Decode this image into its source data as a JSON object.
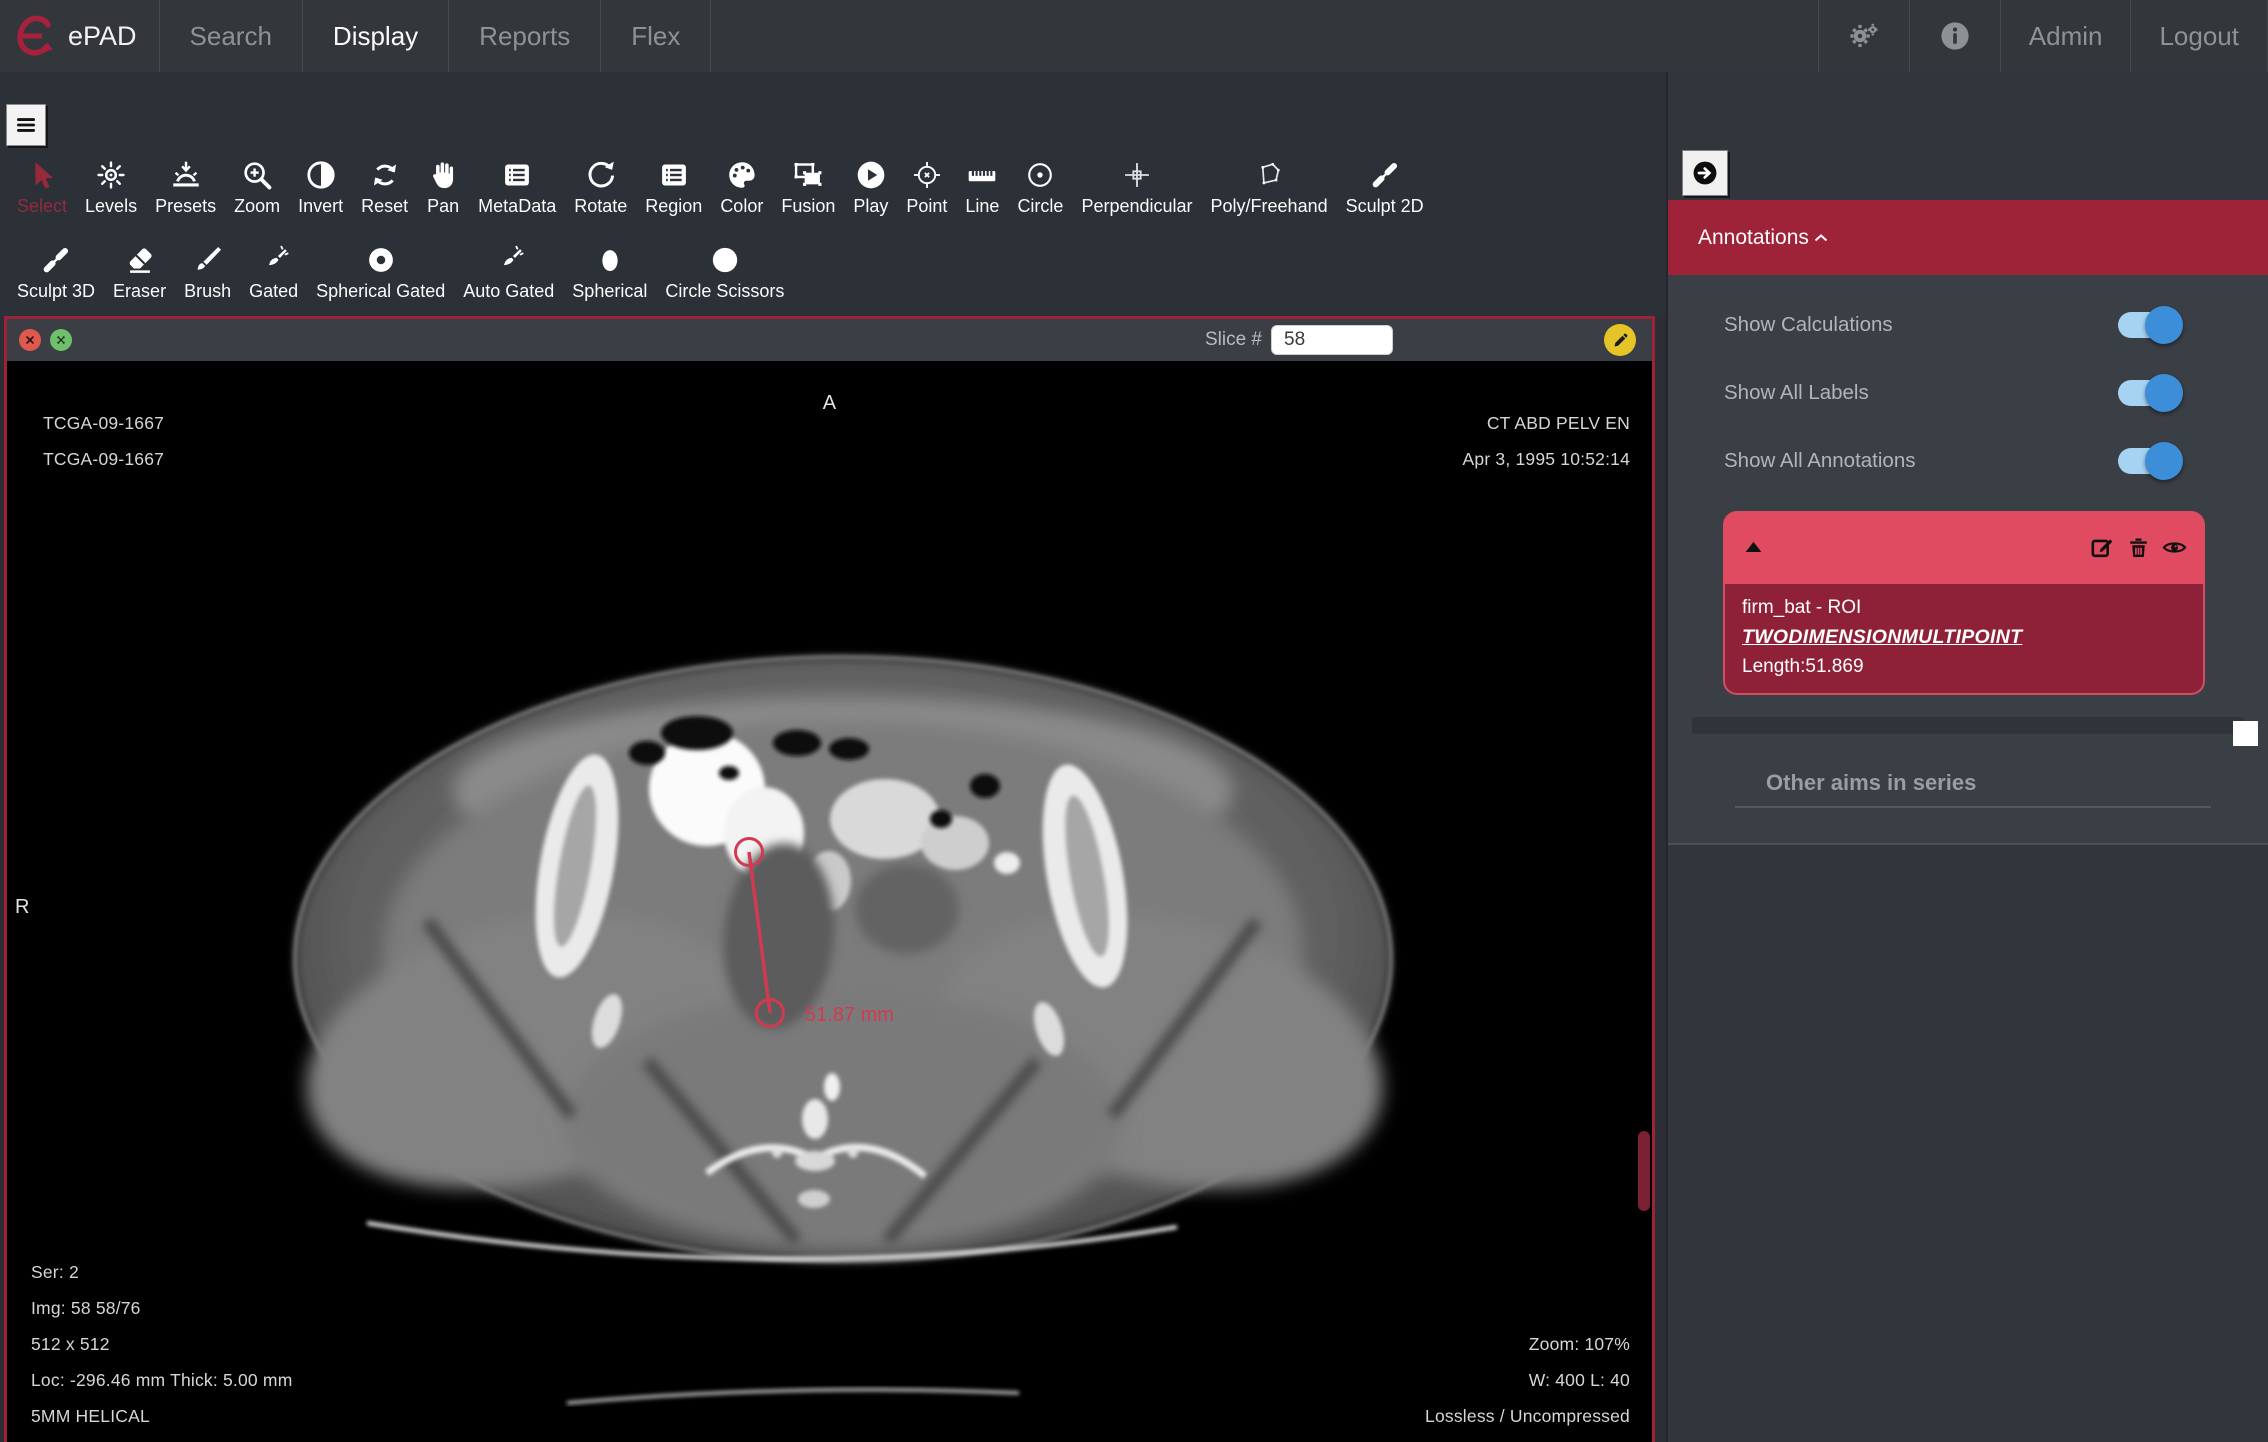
{
  "nav": {
    "brand": "ePAD",
    "logo_icon": "epad-logo",
    "tabs": [
      {
        "label": "Search",
        "active": false
      },
      {
        "label": "Display",
        "active": true
      },
      {
        "label": "Reports",
        "active": false
      },
      {
        "label": "Flex",
        "active": false
      }
    ],
    "settings_icon": "gears-icon",
    "info_icon": "info-icon",
    "admin_label": "Admin",
    "logout_label": "Logout"
  },
  "toolbar": {
    "menu_icon": "hamburger-icon",
    "row1": [
      {
        "label": "Select",
        "icon": "cursor",
        "active": true
      },
      {
        "label": "Levels",
        "icon": "sun"
      },
      {
        "label": "Presets",
        "icon": "sunrise"
      },
      {
        "label": "Zoom",
        "icon": "magnifier-plus"
      },
      {
        "label": "Invert",
        "icon": "half-circle"
      },
      {
        "label": "Reset",
        "icon": "refresh"
      },
      {
        "label": "Pan",
        "icon": "hand"
      },
      {
        "label": "MetaData",
        "icon": "list"
      },
      {
        "label": "Rotate",
        "icon": "rotate-arrow"
      },
      {
        "label": "Region",
        "icon": "list"
      },
      {
        "label": "Color",
        "icon": "palette"
      },
      {
        "label": "Fusion",
        "icon": "fusion-frames"
      },
      {
        "label": "Play",
        "icon": "play-circle"
      },
      {
        "label": "Point",
        "icon": "crosshair-target"
      },
      {
        "label": "Line",
        "icon": "ruler"
      },
      {
        "label": "Circle",
        "icon": "circle-dot"
      },
      {
        "label": "Perpendicular",
        "icon": "crosshair-plus"
      },
      {
        "label": "Poly/Freehand",
        "icon": "polygon"
      },
      {
        "label": "Sculpt 2D",
        "icon": "sculpt-pen"
      }
    ],
    "row2": [
      {
        "label": "Sculpt 3D",
        "icon": "sculpt-pen"
      },
      {
        "label": "Eraser",
        "icon": "eraser"
      },
      {
        "label": "Brush",
        "icon": "brush"
      },
      {
        "label": "Gated",
        "icon": "small-brush"
      },
      {
        "label": "Spherical Gated",
        "icon": "donut"
      },
      {
        "label": "Auto Gated",
        "icon": "small-brush"
      },
      {
        "label": "Spherical",
        "icon": "egg"
      },
      {
        "label": "Circle Scissors",
        "icon": "filled-circle"
      }
    ]
  },
  "viewer": {
    "close_icon": "close-icon",
    "expand_icon": "expand-icon",
    "slice_label": "Slice #",
    "slice_value": "58",
    "edit_icon": "pencil-icon",
    "orientation_top": "A",
    "orientation_left": "R",
    "patient_lines": [
      "TCGA-09-1667",
      "TCGA-09-1667"
    ],
    "study_lines": [
      "CT ABD PELV EN",
      "Apr 3, 1995 10:52:14"
    ],
    "series_lines": [
      "Ser: 2",
      "Img: 58 58/76",
      "512 x 512",
      "Loc: -296.46 mm Thick: 5.00 mm",
      "5MM HELICAL"
    ],
    "display_lines": [
      "Zoom: 107%",
      "W: 400 L: 40",
      "Lossless / Uncompressed"
    ],
    "measurement_label": "51.87 mm"
  },
  "sidebar": {
    "collapse_icon": "arrow-right-icon",
    "panel_title": "Annotations",
    "panel_chevron": "chevron-up-icon",
    "toggles": [
      {
        "label": "Show Calculations",
        "on": true
      },
      {
        "label": "Show All Labels",
        "on": true
      },
      {
        "label": "Show All Annotations",
        "on": true
      }
    ],
    "annotation": {
      "expand_icon": "triangle-up-icon",
      "edit_icon": "edit-icon",
      "delete_icon": "trash-icon",
      "visibility_icon": "eye-icon",
      "title": "firm_bat - ROI",
      "shape": "TWODIMENSIONMULTIPOINT",
      "length": "Length:51.869"
    },
    "other_aims_title": "Other aims in series"
  },
  "colors": {
    "accent": "#9e2238",
    "card_header": "#e04b61",
    "card_body": "#8e2138",
    "toggle_track": "#a7d3f3",
    "toggle_knob": "#3c8ed8",
    "measurement": "#d23a52",
    "edit_button": "#e5c428",
    "close_button": "#e0594e",
    "expand_button": "#6fbf6c"
  }
}
